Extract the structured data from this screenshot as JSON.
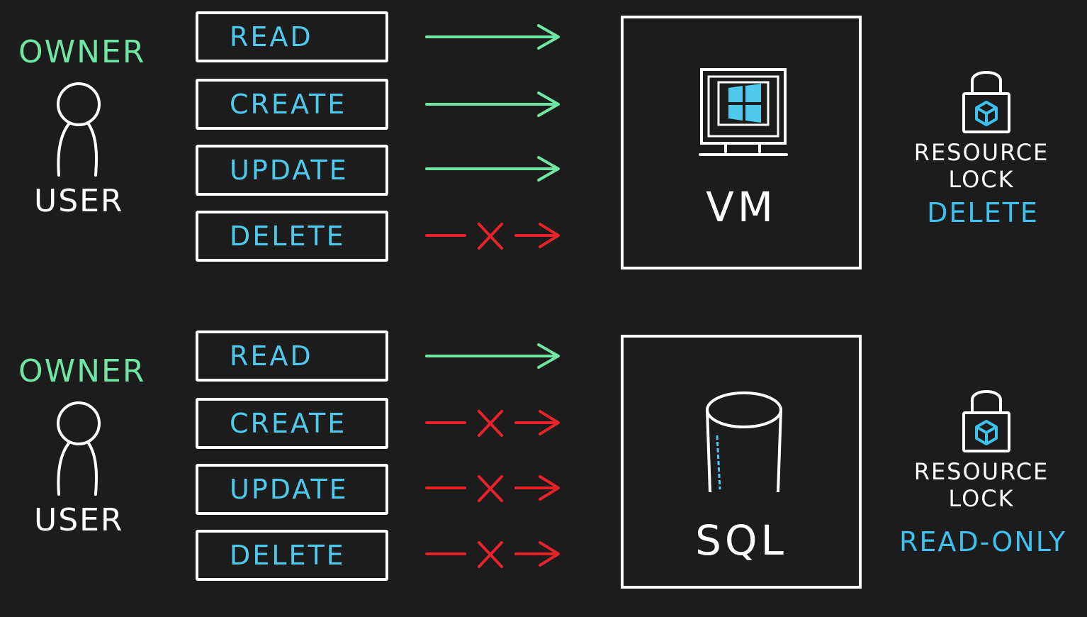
{
  "panels": [
    {
      "role": "OWNER",
      "user": "USER",
      "operations": [
        {
          "label": "READ",
          "allowed": true
        },
        {
          "label": "CREATE",
          "allowed": true
        },
        {
          "label": "UPDATE",
          "allowed": true
        },
        {
          "label": "DELETE",
          "allowed": false
        }
      ],
      "resource": {
        "label": "VM",
        "icon": "windows-monitor-icon"
      },
      "lock": {
        "title_line1": "RESOURCE",
        "title_line2": "LOCK",
        "mode": "DELETE"
      }
    },
    {
      "role": "OWNER",
      "user": "USER",
      "operations": [
        {
          "label": "READ",
          "allowed": true
        },
        {
          "label": "CREATE",
          "allowed": false
        },
        {
          "label": "UPDATE",
          "allowed": false
        },
        {
          "label": "DELETE",
          "allowed": false
        }
      ],
      "resource": {
        "label": "SQL",
        "icon": "database-icon"
      },
      "lock": {
        "title_line1": "RESOURCE",
        "title_line2": "LOCK",
        "mode": "READ-ONLY"
      }
    }
  ],
  "colors": {
    "background": "#1c1c1c",
    "role": "#6fe6a4",
    "operation_text": "#4fc9ec",
    "allowed_arrow": "#6fe6a4",
    "blocked_arrow": "#e8222a",
    "lock_mode": "#3ec1ef"
  }
}
